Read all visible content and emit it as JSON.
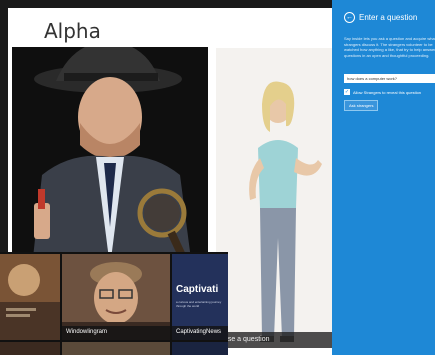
{
  "app": {
    "title": "Alpha"
  },
  "tiles": {
    "detective": {},
    "person": {
      "caption": "...se a question"
    }
  },
  "panel": {
    "title": "Enter a question",
    "description": "Say inside lets you ask a question and acquire what strangers discuss it. The strangers volunteer to be watched how anything a like, that try to help answer questions in an open and thoughtful proceeding.",
    "input_value": "how does a computer work?",
    "checkbox_label": "Allow Strangers to reveal this question",
    "checkbox_checked": true,
    "ask_button": "Ask strangers"
  },
  "overlay": {
    "tiles": [
      {
        "caption": ""
      },
      {
        "caption": "Windowlingram"
      },
      {
        "title": "Captivati",
        "subtitle": "a curious and entertaining journey through the world",
        "caption": "CaptivatingNews"
      }
    ]
  }
}
